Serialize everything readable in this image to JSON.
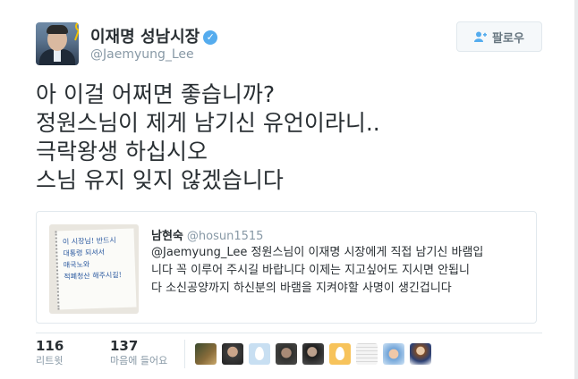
{
  "author": {
    "name": "이재명 성남시장",
    "handle": "@Jaemyung_Lee",
    "verified": true
  },
  "follow_button": {
    "label": "팔로우",
    "icon": "add-user-icon"
  },
  "tweet": {
    "lines": [
      "아 이걸 어쩌면 좋습니까?",
      "정원스님이 제게 남기신 유언이라니..",
      "극락왕생 하십시오",
      "스님 유지 잊지 않겠습니다"
    ]
  },
  "quoted_tweet": {
    "name": "남현숙",
    "handle": "@hosun1515",
    "lines": [
      "@Jaemyung_Lee 정원스님이 이재명 시장에게 직접 남기신 바램입",
      "니다 꼭 이루어 주시길 바랍니다 이제는 지고싶어도 지시면 안됩니",
      "다 소신공양까지 하신분의 바램을 지켜야할 사명이 생긴겁니다"
    ]
  },
  "stats": {
    "retweets": {
      "count": "116",
      "label": "리트윗"
    },
    "likes": {
      "count": "137",
      "label": "마음에 들어요"
    }
  },
  "colors": {
    "accent": "#55acee",
    "text": "#292f33",
    "muted": "#8899a6",
    "border": "#e1e8ed"
  }
}
